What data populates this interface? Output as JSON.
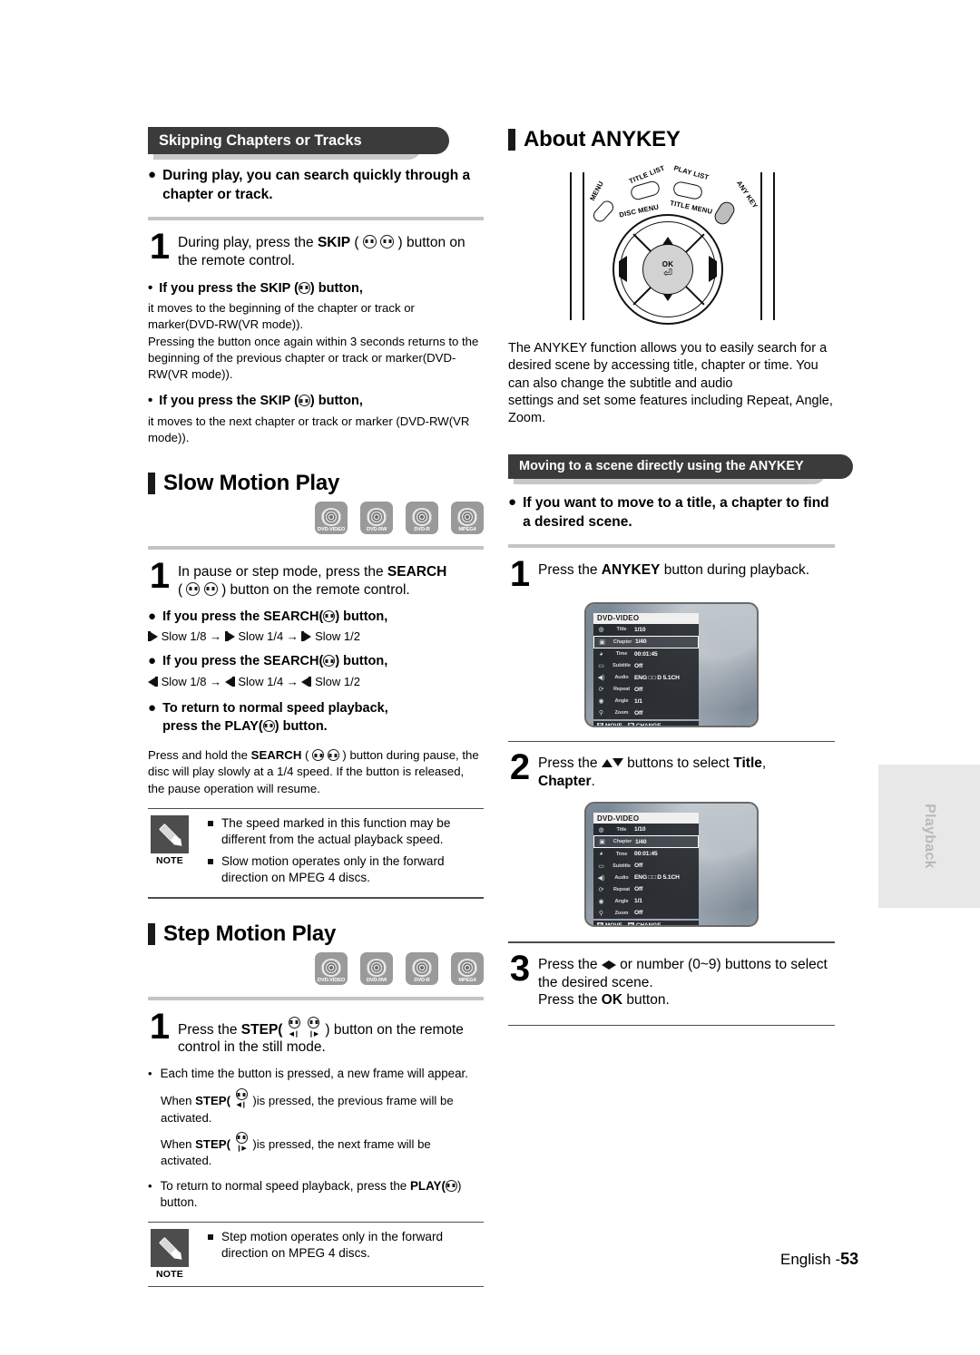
{
  "page": {
    "footer_label": "English -",
    "footer_number": "53",
    "side_tab": "Playback"
  },
  "left_column": {
    "banner": "Skipping Chapters or Tracks",
    "intro_bullet": "During play, you can search quickly through a chapter or track.",
    "step1_pre": "During play, press the",
    "step1_bold": "SKIP",
    "step1_post": ") button on the remote control.",
    "skip_prev": {
      "heading_pre": "If you press the SKIP (",
      "heading_post": ") button,",
      "body": "it moves to the beginning of the chapter or track or marker(DVD-RW(VR mode)).\nPressing the button once again within 3 seconds returns to the beginning of the previous chapter or track or marker(DVD-RW(VR mode))."
    },
    "skip_next": {
      "heading_pre": "If you press the SKIP (",
      "heading_post": ") button,",
      "body": "it moves to the next chapter or track or marker (DVD-RW(VR mode))."
    },
    "slow_motion": {
      "title": "Slow Motion Play",
      "discs": [
        "DVD-VIDEO",
        "DVD-RW",
        "DVD-R",
        "MPEG4"
      ],
      "step1_pre": "In pause or step mode, press the",
      "step1_bold": "SEARCH",
      "step1_post": ") button on the remote control.",
      "forward_heading_pre": "If you press the SEARCH(",
      "forward_heading_post": ") button,",
      "forward_values": [
        "Slow 1/8",
        "Slow 1/4",
        "Slow 1/2"
      ],
      "reverse_heading_pre": "If you press the SEARCH(",
      "reverse_heading_post": ") button,",
      "reverse_values": [
        "Slow 1/8",
        "Slow 1/4",
        "Slow 1/2"
      ],
      "return_line1": "To return to normal speed playback,",
      "return_line2_pre": "press the PLAY(",
      "return_line2_post": ") button.",
      "paragraph_pre": "Press and hold the",
      "paragraph_bold": "SEARCH",
      "paragraph_post": ") button during pause, the disc will play slowly at a 1/4 speed. If the button is released, the pause operation will resume.",
      "note_label": "NOTE",
      "notes": [
        "The speed marked in this function may be different from the actual playback speed.",
        "Slow motion operates only in the forward direction on MPEG 4 discs."
      ]
    },
    "step_motion": {
      "title": "Step Motion Play",
      "discs": [
        "DVD-VIDEO",
        "DVD-RW",
        "DVD-R",
        "MPEG4"
      ],
      "step1_pre": "Press the",
      "step1_bold": "STEP(",
      "step1_post": ") button on the remote control in the still mode.",
      "detail_line1": "Each time the button is pressed, a new frame will appear.",
      "detail_line2_pre": "When",
      "detail_line2_bold": "STEP(",
      "detail_line2_post": ")is pressed, the previous frame will be activated.",
      "detail_line3_pre": "When",
      "detail_line3_bold": "STEP(",
      "detail_line3_post": ")is pressed, the next frame will be activated.",
      "detail_line4_pre": "To return to normal speed playback, press the",
      "detail_line4_bold": "PLAY(",
      "detail_line4_post": ") button.",
      "note_label": "NOTE",
      "notes": [
        "Step motion operates only in the forward direction on MPEG 4 discs."
      ]
    }
  },
  "right_column": {
    "title": "About ANYKEY",
    "remote": {
      "menu_label": "MENU",
      "title_list_label": "TITLE LIST",
      "play_list_label": "PLAY LIST",
      "anykey_label": "ANY KEY",
      "disc_menu_label": "DISC MENU",
      "title_menu_label": "TITLE MENU",
      "ok_label": "OK"
    },
    "description": "The ANYKEY function allows you to easily search for a desired scene by accessing title, chapter or time. You can also change the subtitle and audio\nsettings and set some features including Repeat, Angle, Zoom.",
    "banner": "Moving to a scene directly using the ANYKEY",
    "intro_bullet": "If you want to move to a title, a chapter to find a desired scene.",
    "step1_pre": "Press the",
    "step1_bold": "ANYKEY",
    "step1_post": "button during playback.",
    "step2_pre": "Press the",
    "step2_mid": "buttons to select",
    "step2_bold1": "Title",
    "step2_bold2": "Chapter",
    "step3_pre": "Press the",
    "step3_mid": "or number (0~9) buttons to select the desired scene.",
    "step3_line2_pre": "Press the",
    "step3_line2_bold": "OK",
    "step3_line2_post": "button.",
    "osd": {
      "header": "DVD-VIDEO",
      "rows": [
        {
          "icon": "title-icon",
          "label": "Title",
          "value": "1/10"
        },
        {
          "icon": "chapter-icon",
          "label": "Chapter",
          "value": "1/40"
        },
        {
          "icon": "time-icon",
          "label": "Time",
          "value": "00:01:45"
        },
        {
          "icon": "subtitle-icon",
          "label": "Subtitle",
          "value": "Off"
        },
        {
          "icon": "audio-icon",
          "label": "Audio",
          "value": "ENG □□ D  5.1CH"
        },
        {
          "icon": "repeat-icon",
          "label": "Repeat",
          "value": "Off"
        },
        {
          "icon": "angle-icon",
          "label": "Angle",
          "value": "1/1"
        },
        {
          "icon": "zoom-icon",
          "label": "Zoom",
          "value": "Off"
        }
      ],
      "selected_index_1": 1,
      "selected_index_2": 1,
      "footer_move": "MOVE",
      "footer_change": "CHANGE"
    }
  },
  "colors": {
    "banner_bg": "#3b3b3b",
    "banner_shadow": "#c8c8c8",
    "rule_gray": "#c4c4c4",
    "disc_bg": "#9a9a9a",
    "note_bg": "#4d4d4d",
    "side_tab_bg": "#e8e8e8",
    "side_tab_text": "#b9b9b9"
  }
}
